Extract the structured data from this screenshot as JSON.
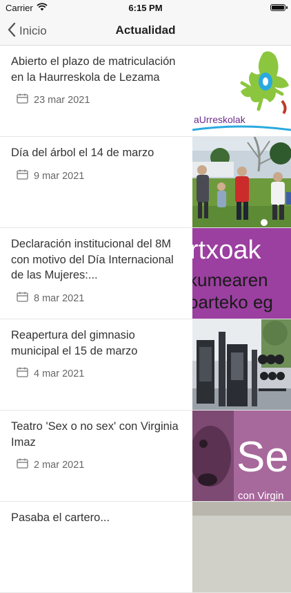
{
  "status_bar": {
    "carrier": "Carrier",
    "time": "6:15 PM",
    "battery_level": 1.0
  },
  "nav": {
    "back_label": "Inicio",
    "title": "Actualidad"
  },
  "news": [
    {
      "title": "Abierto el plazo de matriculación en la Haurreskola de Lezama",
      "date": "23 mar 2021",
      "thumb_text": "aUrreskolak"
    },
    {
      "title": "Día del árbol el 14 de marzo",
      "date": "9 mar 2021"
    },
    {
      "title": "Declaración institucional del 8M con motivo del Día Internacional de las Mujeres:...",
      "date": "8 mar 2021",
      "thumb_lines": [
        "rtxoak",
        "kumearen",
        "oarteko eg"
      ]
    },
    {
      "title": "Reapertura del gimnasio municipal el 15 de marzo",
      "date": "4 mar 2021"
    },
    {
      "title": "Teatro 'Sex o no sex' con Virginia Imaz",
      "date": "2 mar 2021",
      "thumb_big": "Se",
      "thumb_small": "con Virgin"
    },
    {
      "title": "Pasaba el cartero...",
      "date": ""
    }
  ],
  "colors": {
    "purple": "#9b3fa0",
    "bar_bg": "#f7f7f7",
    "divider": "#e6e6e6"
  }
}
